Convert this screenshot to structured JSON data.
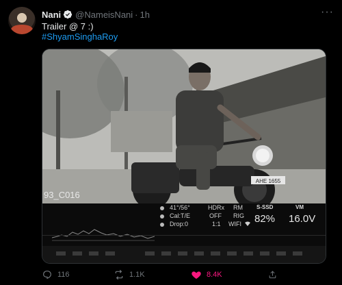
{
  "author": {
    "name": "Nani",
    "handle": "@NameisNani",
    "separator": "·",
    "time": "1h"
  },
  "tweet": {
    "text": "Trailer @ 7 :)",
    "hashtag": "#ShyamSinghaRoy"
  },
  "media": {
    "frame_label": "93_C016",
    "monitor": {
      "row1": [
        "41°/56°",
        "HDRx",
        "RM",
        "S-SSD"
      ],
      "row2": [
        "Cal:T/E",
        "OFF",
        "RIG",
        "82%"
      ],
      "row3": [
        "Drop:0",
        "1:1",
        "WIFI"
      ],
      "vm_label": "VM",
      "vm_value": "16.0V",
      "plate": "AHE 1655"
    }
  },
  "metrics": {
    "replies": "116",
    "retweets": "1.1K",
    "likes": "8.4K"
  },
  "colors": {
    "background": "#000000",
    "accent": "#1d9bf0",
    "like": "#f91880",
    "muted": "#71767b"
  }
}
